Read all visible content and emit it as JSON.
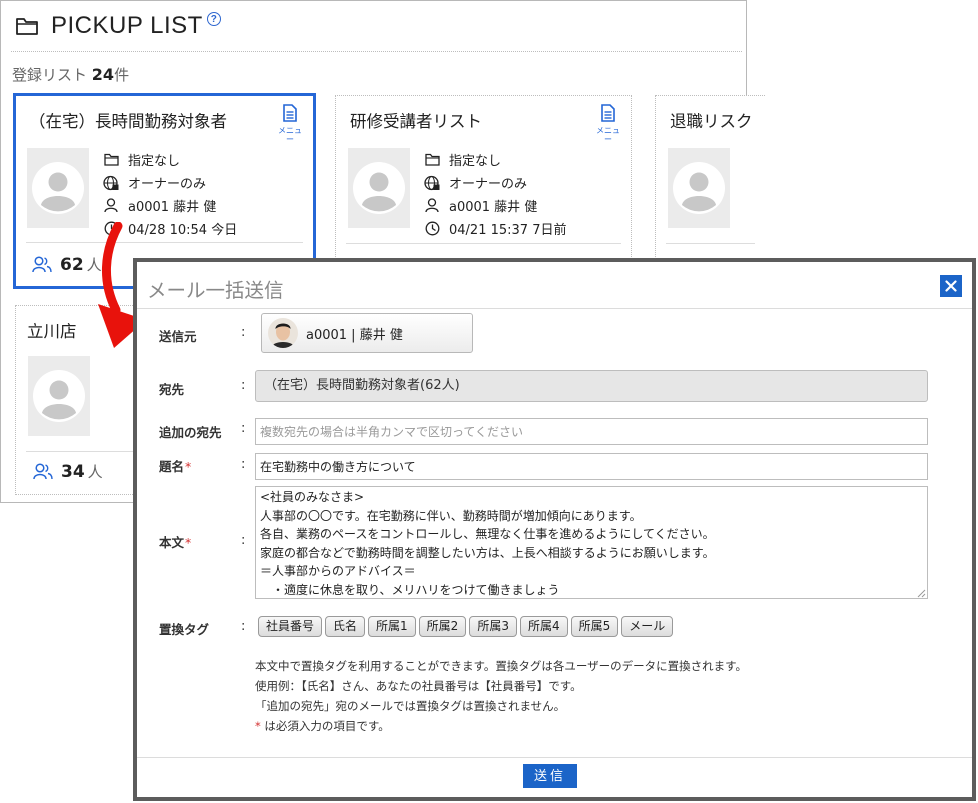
{
  "pickup": {
    "title": "PICKUP LIST",
    "count_label": "登録リスト",
    "count_value": "24",
    "count_unit": "件",
    "menu_label": "メニュー",
    "cards": [
      {
        "title": "（在宅）長時間勤務対象者",
        "folder": "指定なし",
        "visibility": "オーナーのみ",
        "owner": "a0001 藤井 健",
        "date": "04/28 10:54 今日",
        "people": "62",
        "unit": "人"
      },
      {
        "title": "研修受講者リスト",
        "folder": "指定なし",
        "visibility": "オーナーのみ",
        "owner": "a0001 藤井 健",
        "date": "04/21 15:37 7日前"
      },
      {
        "title": "退職リスク"
      },
      {
        "title": "立川店",
        "people": "34",
        "unit": "人"
      }
    ]
  },
  "modal": {
    "title": "メール一括送信",
    "labels": {
      "from": "送信元",
      "to": "宛先",
      "extra_to": "追加の宛先",
      "subject": "題名",
      "body": "本文",
      "tags": "置換タグ",
      "colon": ":",
      "required_mark": "*"
    },
    "from_value": "a0001 | 藤井 健",
    "to_value": "（在宅）長時間勤務対象者(62人)",
    "extra_to_placeholder": "複数宛先の場合は半角カンマで区切ってください",
    "subject_value": "在宅勤務中の働き方について",
    "body_value": "<社員のみなさま>\n人事部の〇〇です。在宅勤務に伴い、勤務時間が増加傾向にあります。\n各自、業務のペースをコントロールし、無理なく仕事を進めるようにしてください。\n家庭の都合などで勤務時間を調整したい方は、上長へ相談するようにお願いします。\n＝人事部からのアドバイス＝\n　・適度に休息を取り、メリハリをつけて働きましょう",
    "tags": [
      "社員番号",
      "氏名",
      "所属1",
      "所属2",
      "所属3",
      "所属4",
      "所属5",
      "メール"
    ],
    "help": [
      "本文中で置換タグを利用することができます。置換タグは各ユーザーのデータに置換されます。",
      "使用例：【氏名】さん、あなたの社員番号は【社員番号】です。",
      "「追加の宛先」宛のメールでは置換タグは置換されません。"
    ],
    "required_note": "は必須入力の項目です。",
    "send_label": "送信"
  },
  "colors": {
    "accent": "#1b64c8",
    "selected_border": "#2466d6",
    "required": "#d32f2f",
    "arrow": "#e8120c",
    "modal_frame": "#5c5c5c"
  }
}
